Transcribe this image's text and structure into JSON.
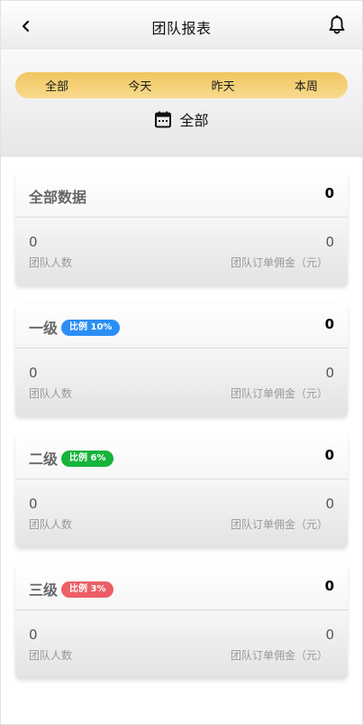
{
  "header": {
    "title": "团队报表",
    "back_icon": "chevron-left-icon",
    "bell_icon": "bell-icon"
  },
  "filter": {
    "tabs": [
      {
        "label": "全部"
      },
      {
        "label": "今天"
      },
      {
        "label": "昨天"
      },
      {
        "label": "本周"
      }
    ],
    "selected_range": "全部",
    "calendar_icon": "calendar-icon",
    "tab_gradient": [
      "#f0c660",
      "#f8da8e"
    ]
  },
  "cards": [
    {
      "title": "全部数据",
      "badge": null,
      "total": "0",
      "team_count": "0",
      "team_count_label": "团队人数",
      "commission": "0",
      "commission_label": "团队订单佣金（元）"
    },
    {
      "title": "一级",
      "badge": {
        "text": "比例 10%",
        "color": "#2b8ef5"
      },
      "total": "0",
      "team_count": "0",
      "team_count_label": "团队人数",
      "commission": "0",
      "commission_label": "团队订单佣金（元）"
    },
    {
      "title": "二级",
      "badge": {
        "text": "比例 6%",
        "color": "#17b33a"
      },
      "total": "0",
      "team_count": "0",
      "team_count_label": "团队人数",
      "commission": "0",
      "commission_label": "团队订单佣金（元）"
    },
    {
      "title": "三级",
      "badge": {
        "text": "比例 3%",
        "color": "#ec5f66"
      },
      "total": "0",
      "team_count": "0",
      "team_count_label": "团队人数",
      "commission": "0",
      "commission_label": "团队订单佣金（元）"
    }
  ]
}
